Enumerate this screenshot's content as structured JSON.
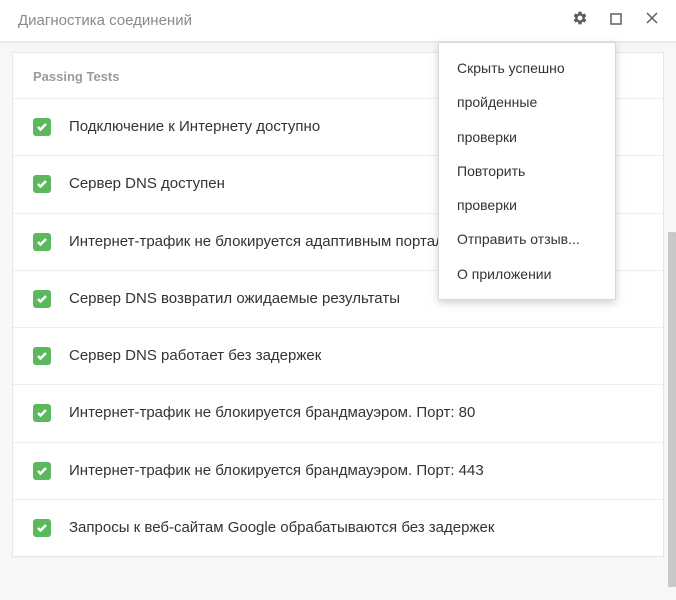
{
  "window": {
    "title": "Диагностика соединений"
  },
  "section": {
    "header": "Passing Tests"
  },
  "tests": [
    {
      "label": "Подключение к Интернету доступно"
    },
    {
      "label": "Сервер DNS доступен"
    },
    {
      "label": "Интернет-трафик не блокируется адаптивным порталом (HTTP)"
    },
    {
      "label": "Сервер DNS возвратил ожидаемые результаты"
    },
    {
      "label": "Сервер DNS работает без задержек"
    },
    {
      "label": "Интернет-трафик не блокируется брандмауэром. Порт: 80"
    },
    {
      "label": "Интернет-трафик не блокируется брандмауэром. Порт: 443"
    },
    {
      "label": "Запросы к веб-сайтам Google обрабатываются без задержек"
    }
  ],
  "menu": {
    "items": [
      {
        "label": "Скрыть успешно"
      },
      {
        "label": "пройденные"
      },
      {
        "label": "проверки"
      },
      {
        "label": "Повторить"
      },
      {
        "label": "проверки"
      },
      {
        "label": "Отправить отзыв..."
      },
      {
        "label": "О приложении"
      }
    ]
  },
  "colors": {
    "success": "#5cb85c"
  }
}
